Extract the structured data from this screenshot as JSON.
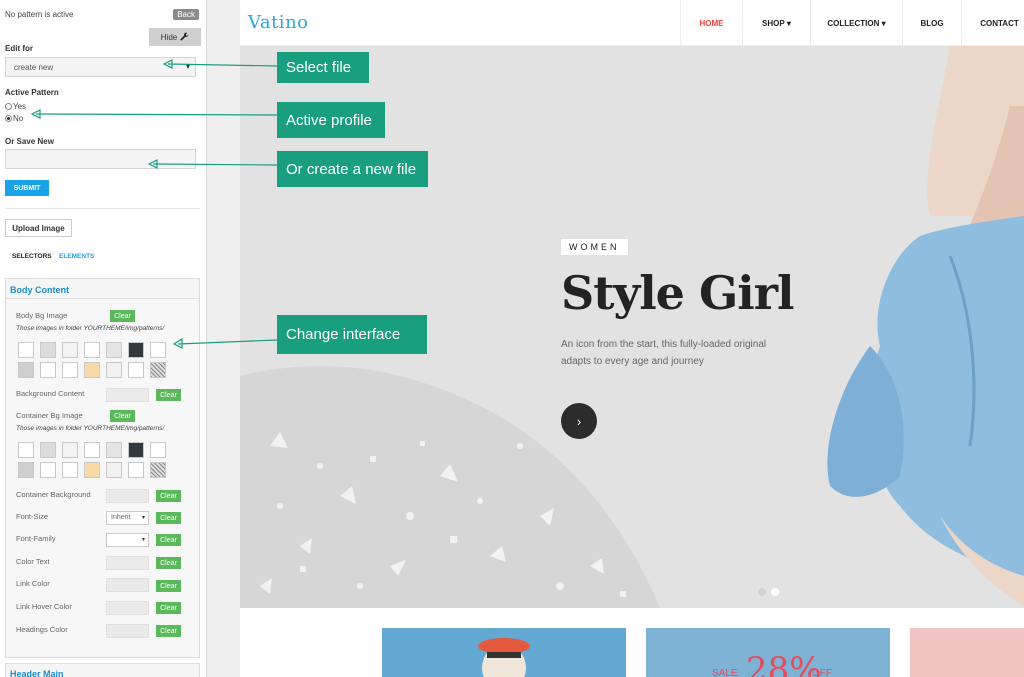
{
  "panel": {
    "status": "No pattern is active",
    "back_label": "Back",
    "hide_label": "Hide",
    "edit_for_label": "Edit for",
    "edit_for_value": "create new",
    "active_pattern_label": "Active Pattern",
    "radio_yes": "Yes",
    "radio_no": "No",
    "radio_selected": "No",
    "save_new_label": "Or Save New",
    "save_new_value": "",
    "submit_label": "SUBMIT",
    "upload_label": "Upload Image",
    "tabs": [
      "SELECTORS",
      "ELEMENTS"
    ],
    "active_tab": "ELEMENTS",
    "body_content": {
      "title": "Body Content",
      "body_bg_label": "Body Bg Image",
      "clear_label": "Clear",
      "patterns_note": "Those images in folder YOURTHEME/img/patterns/",
      "bg_content_label": "Background Content",
      "container_bg_image_label": "Container Bg Image",
      "container_bg_label": "Container Background",
      "font_size_label": "Font-Size",
      "font_size_value": "Inherit",
      "font_family_label": "Font-Family",
      "font_family_value": "",
      "color_text_label": "Color Text",
      "link_color_label": "Link Color",
      "link_hover_label": "Link Hover Color",
      "headings_color_label": "Headings Color"
    },
    "header_main_title": "Header Main"
  },
  "site": {
    "logo": "Vatino",
    "nav": [
      "HOME",
      "SHOP",
      "COLLECTION",
      "BLOG",
      "CONTACT"
    ],
    "nav_active": "HOME",
    "hero_tag": "WOMEN",
    "hero_title": "Style Girl",
    "hero_desc": "An icon from the start, this fully-loaded original adapts to every age and journey",
    "hero_btn_icon": "chevron-right-icon",
    "card_sale_text": "SALE",
    "card_percent": "28%",
    "card_off": "OFF"
  },
  "callouts": {
    "select_file": "Select file",
    "active_profile": "Active profile",
    "new_file": "Or create a new file",
    "change_interface": "Change interface"
  },
  "colors": {
    "accent_blue": "#1aa3e8",
    "callout_green": "#1a9e80",
    "clear_green": "#5cb85c",
    "nav_active": "#e8453c"
  }
}
